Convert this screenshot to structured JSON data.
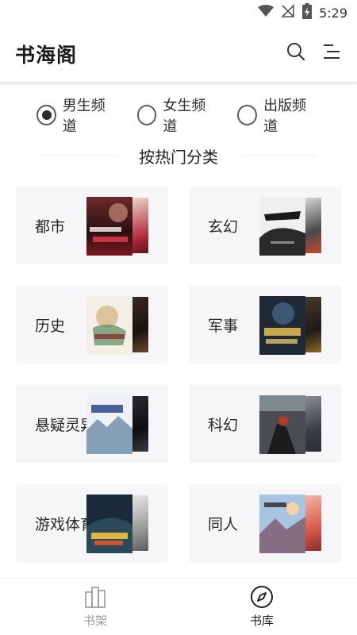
{
  "status_bar": {
    "time": "5:29",
    "icons": [
      "wifi-icon",
      "no-signal-icon",
      "battery-charging-icon"
    ]
  },
  "header": {
    "title": "书海阁",
    "icons": [
      "search-icon",
      "menu-icon"
    ]
  },
  "channels": [
    {
      "label": "男生频道",
      "selected": true
    },
    {
      "label": "女生频道",
      "selected": false
    },
    {
      "label": "出版频道",
      "selected": false
    }
  ],
  "section": {
    "title": "按热门分类"
  },
  "categories": [
    {
      "label": "都市"
    },
    {
      "label": "玄幻"
    },
    {
      "label": "历史"
    },
    {
      "label": "军事"
    },
    {
      "label": "悬疑灵异"
    },
    {
      "label": "科幻"
    },
    {
      "label": "游戏体育"
    },
    {
      "label": "同人"
    }
  ],
  "bottom_nav": [
    {
      "label": "书架",
      "icon": "bookshelf-icon",
      "active": false
    },
    {
      "label": "书库",
      "icon": "compass-icon",
      "active": true
    }
  ],
  "colors": {
    "card_bg": "#f6f6f8",
    "text_primary": "#222222",
    "text_inactive": "#9a9a9a"
  }
}
